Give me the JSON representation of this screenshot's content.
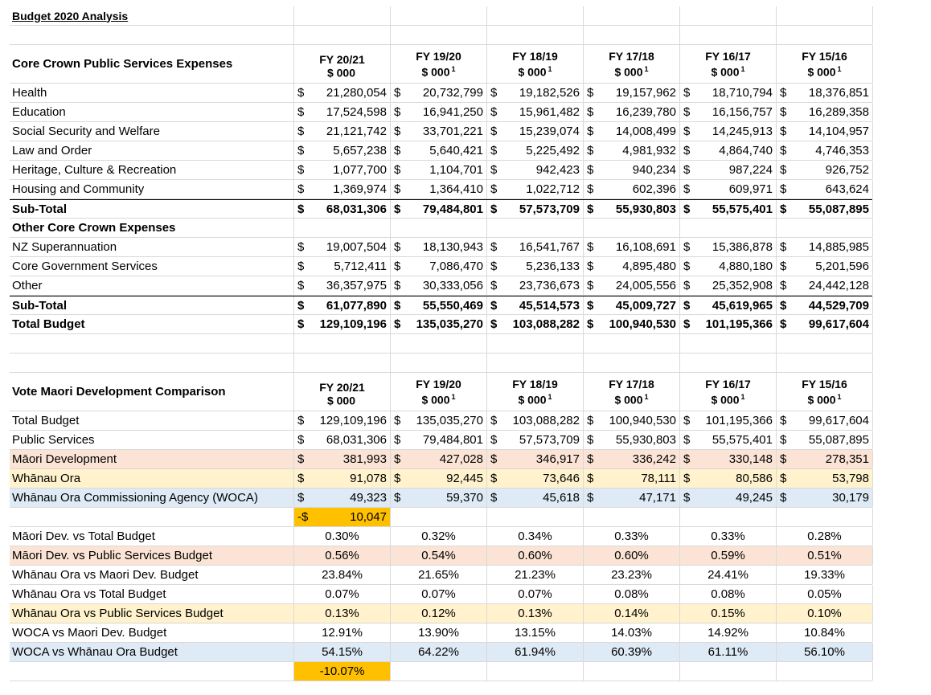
{
  "title": "Budget 2020 Analysis",
  "columns": [
    {
      "fy": "FY 20/21",
      "unit": "$ 000",
      "note": ""
    },
    {
      "fy": "FY 19/20",
      "unit": "$ 000",
      "note": "1"
    },
    {
      "fy": "FY 18/19",
      "unit": "$ 000",
      "note": "1"
    },
    {
      "fy": "FY 17/18",
      "unit": "$ 000",
      "note": "1"
    },
    {
      "fy": "FY 16/17",
      "unit": "$ 000",
      "note": "1"
    },
    {
      "fy": "FY 15/16",
      "unit": "$ 000",
      "note": "1"
    }
  ],
  "section1": {
    "heading": "Core Crown Public Services Expenses",
    "rows": [
      {
        "label": "Health",
        "values": [
          "21,280,054",
          "20,732,799",
          "19,182,526",
          "19,157,962",
          "18,710,794",
          "18,376,851"
        ]
      },
      {
        "label": "Education",
        "values": [
          "17,524,598",
          "16,941,250",
          "15,961,482",
          "16,239,780",
          "16,156,757",
          "16,289,358"
        ]
      },
      {
        "label": "Social Security and Welfare",
        "values": [
          "21,121,742",
          "33,701,221",
          "15,239,074",
          "14,008,499",
          "14,245,913",
          "14,104,957"
        ]
      },
      {
        "label": "Law and Order",
        "values": [
          "5,657,238",
          "5,640,421",
          "5,225,492",
          "4,981,932",
          "4,864,740",
          "4,746,353"
        ]
      },
      {
        "label": "Heritage, Culture & Recreation",
        "values": [
          "1,077,700",
          "1,104,701",
          "942,423",
          "940,234",
          "987,224",
          "926,752"
        ]
      },
      {
        "label": "Housing and Community",
        "values": [
          "1,369,974",
          "1,364,410",
          "1,022,712",
          "602,396",
          "609,971",
          "643,624"
        ]
      }
    ],
    "subtotal": {
      "label": "Sub-Total",
      "values": [
        "68,031,306",
        "79,484,801",
        "57,573,709",
        "55,930,803",
        "55,575,401",
        "55,087,895"
      ]
    },
    "other_heading": "Other Core Crown Expenses",
    "other_rows": [
      {
        "label": "NZ Superannuation",
        "values": [
          "19,007,504",
          "18,130,943",
          "16,541,767",
          "16,108,691",
          "15,386,878",
          "14,885,985"
        ]
      },
      {
        "label": "Core Government Services",
        "values": [
          "5,712,411",
          "7,086,470",
          "5,236,133",
          "4,895,480",
          "4,880,180",
          "5,201,596"
        ]
      },
      {
        "label": "Other",
        "values": [
          "36,357,975",
          "30,333,056",
          "23,736,673",
          "24,005,556",
          "25,352,908",
          "24,442,128"
        ]
      }
    ],
    "other_subtotal": {
      "label": "Sub-Total",
      "values": [
        "61,077,890",
        "55,550,469",
        "45,514,573",
        "45,009,727",
        "45,619,965",
        "44,529,709"
      ]
    },
    "total": {
      "label": "Total Budget",
      "values": [
        "129,109,196",
        "135,035,270",
        "103,088,282",
        "100,940,530",
        "101,195,366",
        "99,617,604"
      ]
    }
  },
  "section2": {
    "heading": "Vote Maori Development Comparison",
    "rows": [
      {
        "label": "Total Budget",
        "values": [
          "129,109,196",
          "135,035,270",
          "103,088,282",
          "100,940,530",
          "101,195,366",
          "99,617,604"
        ],
        "bg": ""
      },
      {
        "label": "Public Services",
        "values": [
          "68,031,306",
          "79,484,801",
          "57,573,709",
          "55,930,803",
          "55,575,401",
          "55,087,895"
        ],
        "bg": ""
      },
      {
        "label": "Māori Development",
        "values": [
          "381,993",
          "427,028",
          "346,917",
          "336,242",
          "330,148",
          "278,351"
        ],
        "bg": "pink"
      },
      {
        "label": "Whānau Ora",
        "values": [
          "91,078",
          "92,445",
          "73,646",
          "78,111",
          "80,586",
          "53,798"
        ],
        "bg": "yellow"
      },
      {
        "label": "Whānau Ora Commissioning Agency (WOCA)",
        "values": [
          "49,323",
          "59,370",
          "45,618",
          "47,171",
          "49,245",
          "30,179"
        ],
        "bg": "blue"
      }
    ],
    "diff_value": {
      "prefix": "-$",
      "amount": "10,047"
    },
    "pct_rows": [
      {
        "label": "Māori Dev. vs Total Budget",
        "values": [
          "0.30%",
          "0.32%",
          "0.34%",
          "0.33%",
          "0.33%",
          "0.28%"
        ],
        "bg": ""
      },
      {
        "label": "Māori Dev. vs Public Services Budget",
        "values": [
          "0.56%",
          "0.54%",
          "0.60%",
          "0.60%",
          "0.59%",
          "0.51%"
        ],
        "bg": "pink"
      },
      {
        "label": "Whānau Ora vs Maori Dev. Budget",
        "values": [
          "23.84%",
          "21.65%",
          "21.23%",
          "23.23%",
          "24.41%",
          "19.33%"
        ],
        "bg": ""
      },
      {
        "label": "Whānau Ora vs Total Budget",
        "values": [
          "0.07%",
          "0.07%",
          "0.07%",
          "0.08%",
          "0.08%",
          "0.05%"
        ],
        "bg": ""
      },
      {
        "label": "Whānau Ora vs Public Services Budget",
        "values": [
          "0.13%",
          "0.12%",
          "0.13%",
          "0.14%",
          "0.15%",
          "0.10%"
        ],
        "bg": "yellow"
      },
      {
        "label": "WOCA vs Maori Dev. Budget",
        "values": [
          "12.91%",
          "13.90%",
          "13.15%",
          "14.03%",
          "14.92%",
          "10.84%"
        ],
        "bg": ""
      },
      {
        "label": "WOCA vs Whānau Ora Budget",
        "values": [
          "54.15%",
          "64.22%",
          "61.94%",
          "60.39%",
          "61.11%",
          "56.10%"
        ],
        "bg": "blue"
      }
    ],
    "diff_pct": "-10.07%"
  },
  "colors": {
    "pink": "#fbe4d5",
    "yellow": "#fff2cc",
    "blue": "#deeaf6",
    "orange": "#ffc000",
    "gridline": "#d9d9d9"
  },
  "currency_symbol": "$"
}
